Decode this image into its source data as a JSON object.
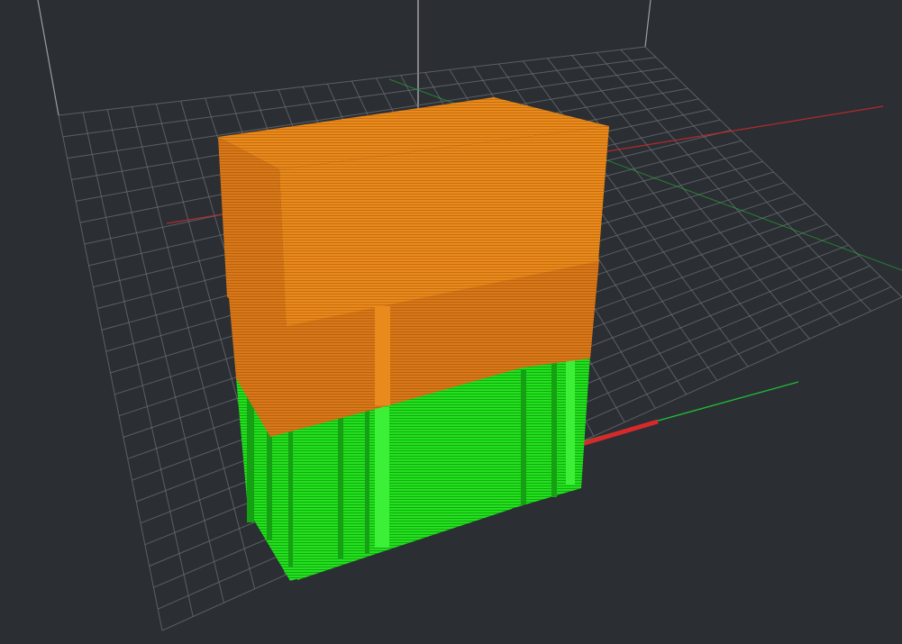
{
  "app": {
    "view": "3D preview",
    "description_of_content": ""
  },
  "scene": {
    "background_color": "#2b2e33",
    "grid_color": "#6b6f75",
    "bed_edge_color": "#9a9da2",
    "axis_x_color": "#d62a2a",
    "axis_y_color": "#20b838",
    "axis_z_color": "#bfbfbf",
    "model_color": "#e88a1c",
    "model_shade_color": "#c96e0f",
    "support_color": "#22e21e",
    "support_shade_color": "#16a013"
  }
}
